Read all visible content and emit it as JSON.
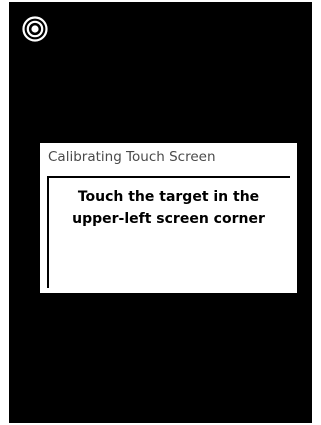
{
  "screen": {
    "background_color": "#000000",
    "target_icon": "calibration-target-icon"
  },
  "dialog": {
    "title": "Calibrating Touch Screen",
    "instruction_line1": "Touch the target in the",
    "instruction_line2": "upper-left screen corner"
  }
}
